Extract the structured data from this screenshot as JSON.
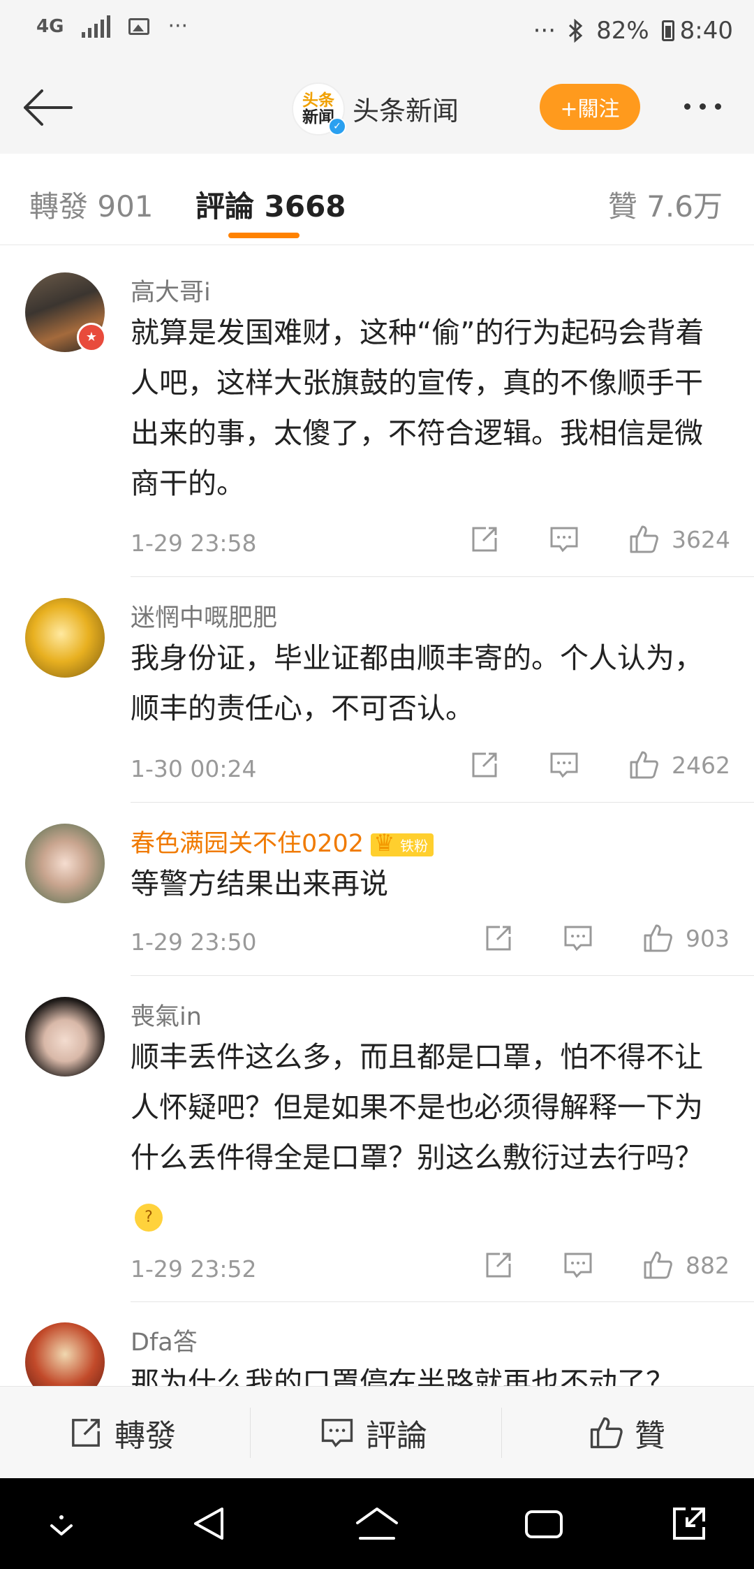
{
  "status_bar": {
    "network": "4G",
    "dots": "···",
    "battery": "82%",
    "time": "8:40"
  },
  "header": {
    "logo_line1": "头条",
    "logo_line2": "新闻",
    "title": "头条新闻",
    "follow_label": "+關注"
  },
  "tabs": {
    "repost": "轉發 901",
    "comment": "評論 3668",
    "like": "贊 7.6万"
  },
  "comments": [
    {
      "name": "高大哥i",
      "text": "就算是发国难财，这种“偷”的行为起码会背着人吧，这样大张旗鼓的宣传，真的不像顺手干出来的事，太傻了，不符合逻辑。我相信是微商干的。",
      "time": "1-29 23:58",
      "likes": "3624"
    },
    {
      "name": "迷惘中嘅肥肥",
      "text": "我身份证，毕业证都由顺丰寄的。个人认为，顺丰的责任心，不可否认。",
      "time": "1-30 00:24",
      "likes": "2462"
    },
    {
      "name": "春色满园关不住0202",
      "fan_badge": "铁粉",
      "text": "等警方结果出来再说",
      "time": "1-29 23:50",
      "likes": "903"
    },
    {
      "name": "喪氣in",
      "text": "顺丰丢件这么多，而且都是口罩，怕不得不让人怀疑吧？但是如果不是也必须得解释一下为什么丢件得全是口罩？别这么敷衍过去行吗？",
      "time": "1-29 23:52",
      "likes": "882"
    },
    {
      "name": "Dfa答",
      "text": "那为什么我的口罩停在半路就再也不动了？"
    }
  ],
  "bottom_bar": {
    "repost": "轉發",
    "comment": "評論",
    "like": "贊"
  },
  "colors": {
    "accent": "#ff8200",
    "follow_button": "#ff9a1d",
    "vip_name": "#f07a00"
  }
}
